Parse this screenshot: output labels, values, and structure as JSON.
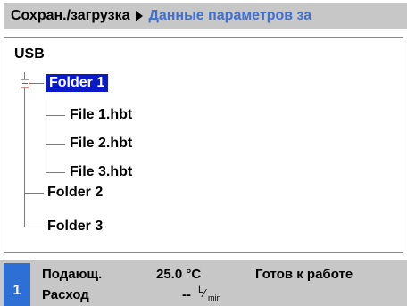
{
  "breadcrumb": {
    "root": "Сохран./загрузка",
    "current": "Данные параметров за"
  },
  "tree": {
    "root_label": "USB",
    "nodes": [
      {
        "label": "Folder 1",
        "expanded": true,
        "selected": true,
        "children": [
          "File 1.hbt",
          "File 2.hbt",
          "File 3.hbt"
        ]
      },
      {
        "label": "Folder 2"
      },
      {
        "label": "Folder 3"
      }
    ]
  },
  "status": {
    "channel": "1",
    "supply_label": "Подающ.",
    "supply_value": "25.0 °C",
    "flow_label": "Расход",
    "flow_value": "--",
    "flow_unit_top": "L",
    "flow_unit_bottom": "min",
    "state": "Готов к работе"
  },
  "colors": {
    "bar_bg": "#c7c7c7",
    "breadcrumb_current": "#3f6fd0",
    "selection_bg": "#0a1ac8",
    "channel_badge": "#2e6fd6"
  }
}
